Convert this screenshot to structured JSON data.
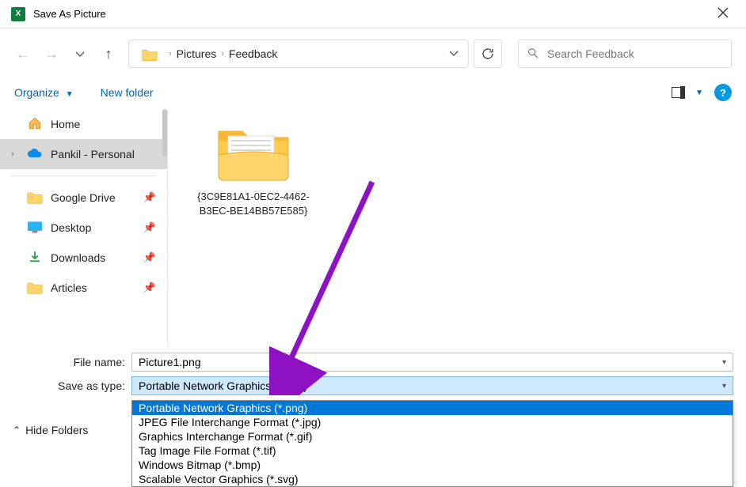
{
  "title": "Save As Picture",
  "breadcrumb": {
    "items": [
      "Pictures",
      "Feedback"
    ]
  },
  "search": {
    "placeholder": "Search Feedback"
  },
  "toolbar": {
    "organize": "Organize",
    "new_folder": "New folder"
  },
  "sidebar": {
    "items": [
      {
        "label": "Home"
      },
      {
        "label": "Pankil - Personal"
      },
      {
        "label": "Google Drive"
      },
      {
        "label": "Desktop"
      },
      {
        "label": "Downloads"
      },
      {
        "label": "Articles"
      }
    ]
  },
  "content": {
    "folder_name": "{3C9E81A1-0EC2-4462-B3EC-BE14BB57E585}"
  },
  "form": {
    "filename_label": "File name:",
    "filename_value": "Picture1.png",
    "type_label": "Save as type:",
    "type_selected": "Portable Network Graphics (*.png)",
    "type_options": [
      "Portable Network Graphics (*.png)",
      "JPEG File Interchange Format (*.jpg)",
      "Graphics Interchange Format (*.gif)",
      "Tag Image File Format (*.tif)",
      "Windows Bitmap (*.bmp)",
      "Scalable Vector Graphics (*.svg)"
    ]
  },
  "footer": {
    "hide_folders": "Hide Folders"
  }
}
